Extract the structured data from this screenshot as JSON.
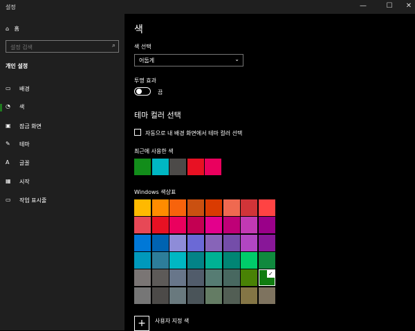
{
  "window": {
    "title": "설정",
    "controls": {
      "minimize": "—",
      "maximize": "☐",
      "close": "✕"
    }
  },
  "sidebar": {
    "home_label": "홈",
    "search_placeholder": "설정 검색",
    "section_title": "개인 설정",
    "items": [
      {
        "label": "배경",
        "icon": "image-icon"
      },
      {
        "label": "색",
        "icon": "palette-icon"
      },
      {
        "label": "잠금 화면",
        "icon": "lock-screen-icon"
      },
      {
        "label": "테마",
        "icon": "theme-icon"
      },
      {
        "label": "글꼴",
        "icon": "font-icon"
      },
      {
        "label": "시작",
        "icon": "start-icon"
      },
      {
        "label": "작업 표시줄",
        "icon": "taskbar-icon"
      }
    ]
  },
  "main": {
    "title": "색",
    "choose_color_label": "색 선택",
    "choose_color_value": "어둡게",
    "transparency_label": "투명 효과",
    "transparency_state": "끔",
    "accent_heading": "테마 컬러 선택",
    "auto_checkbox_label": "자동으로 내 배경 화면에서 테마 컬러 선택",
    "recent_label": "최근에 사용한 색",
    "recent_colors": [
      "#128d1a",
      "#00b7c3",
      "#4c4a48",
      "#e81123",
      "#ea005e"
    ],
    "palette_label": "Windows 색상표",
    "palette_colors": [
      [
        "#ffb900",
        "#ff8c00",
        "#f7630c",
        "#ca5010",
        "#da3b01",
        "#ef6950",
        "#d13438",
        "#ff4343"
      ],
      [
        "#e74856",
        "#e81123",
        "#ea005e",
        "#c30052",
        "#e3008c",
        "#bf0077",
        "#c239b3",
        "#9a0089"
      ],
      [
        "#0078d7",
        "#0063b1",
        "#8e8cd8",
        "#6b69d6",
        "#8764b8",
        "#744da9",
        "#b146c2",
        "#881798"
      ],
      [
        "#0099bc",
        "#2d7d9a",
        "#00b7c3",
        "#038387",
        "#00b294",
        "#018574",
        "#00cc6a",
        "#10893e"
      ],
      [
        "#7a7574",
        "#5d5a58",
        "#68768a",
        "#515c6b",
        "#567c73",
        "#486860",
        "#498205",
        "#107c10"
      ],
      [
        "#767676",
        "#4c4a48",
        "#69797e",
        "#4a5459",
        "#647c64",
        "#525e54",
        "#847545",
        "#7e735f"
      ]
    ],
    "selected_palette": [
      4,
      7
    ],
    "custom_color_label": "사용자 지정 색"
  }
}
